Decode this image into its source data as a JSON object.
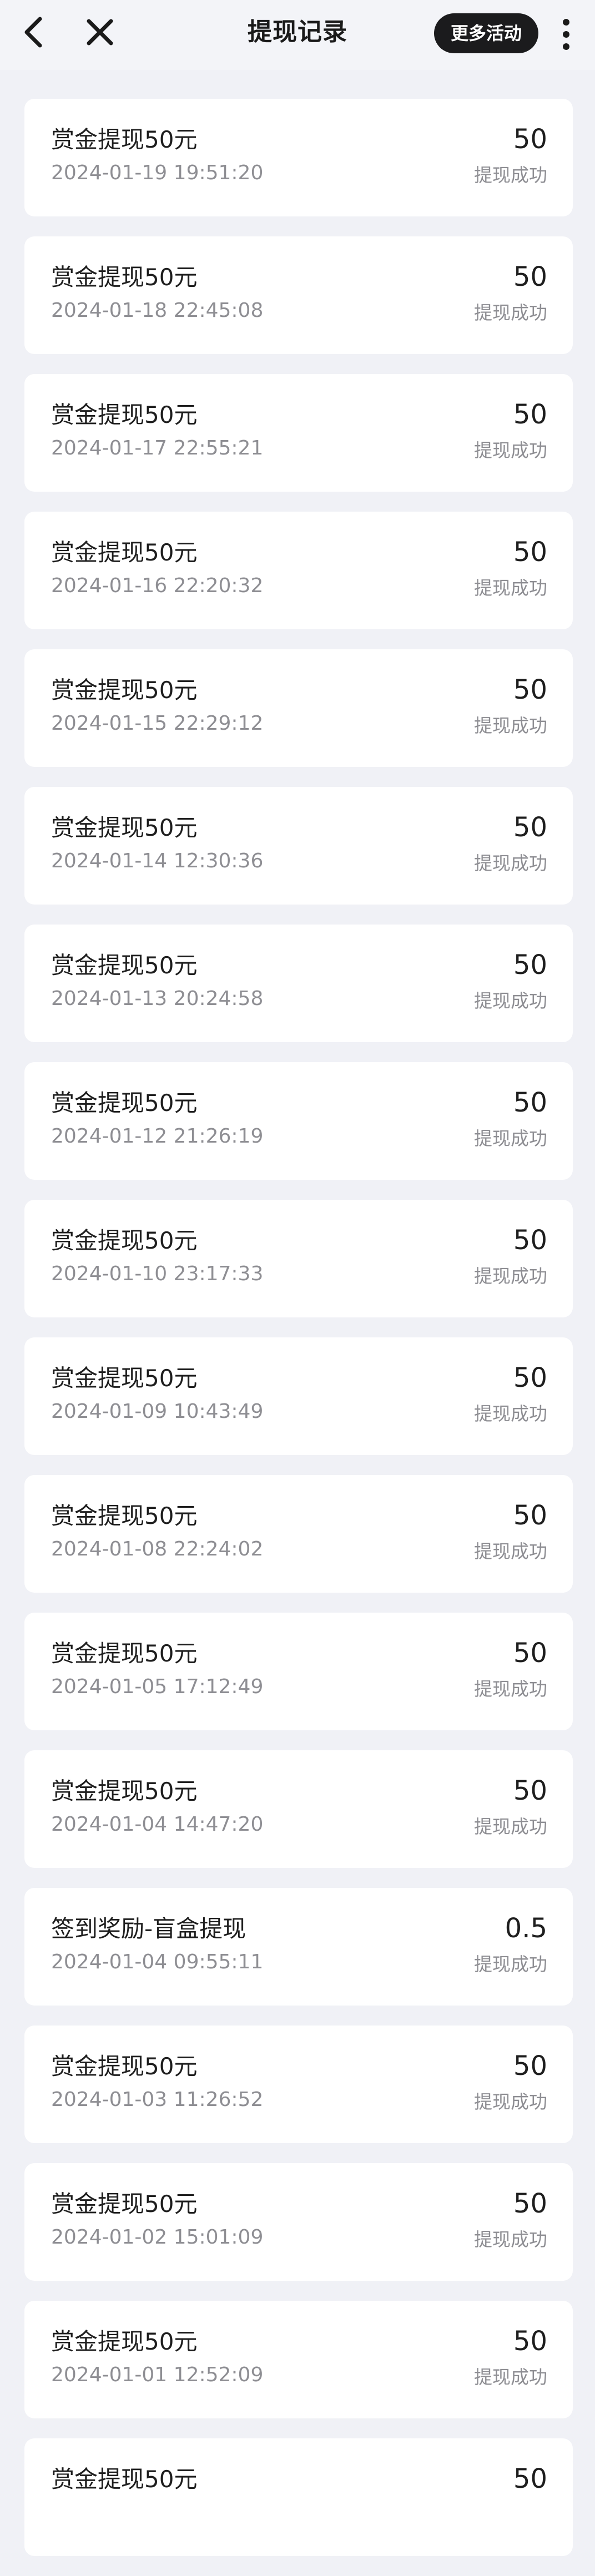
{
  "header": {
    "title": "提现记录",
    "more_label": "更多活动",
    "back_icon": "chevron-left-icon",
    "close_icon": "close-icon",
    "menu_icon": "vertical-ellipsis-icon"
  },
  "records": [
    {
      "title": "赏金提现50元",
      "time": "2024-01-19 19:51:20",
      "amount": "50",
      "status": "提现成功"
    },
    {
      "title": "赏金提现50元",
      "time": "2024-01-18 22:45:08",
      "amount": "50",
      "status": "提现成功"
    },
    {
      "title": "赏金提现50元",
      "time": "2024-01-17 22:55:21",
      "amount": "50",
      "status": "提现成功"
    },
    {
      "title": "赏金提现50元",
      "time": "2024-01-16 22:20:32",
      "amount": "50",
      "status": "提现成功"
    },
    {
      "title": "赏金提现50元",
      "time": "2024-01-15 22:29:12",
      "amount": "50",
      "status": "提现成功"
    },
    {
      "title": "赏金提现50元",
      "time": "2024-01-14 12:30:36",
      "amount": "50",
      "status": "提现成功"
    },
    {
      "title": "赏金提现50元",
      "time": "2024-01-13 20:24:58",
      "amount": "50",
      "status": "提现成功"
    },
    {
      "title": "赏金提现50元",
      "time": "2024-01-12 21:26:19",
      "amount": "50",
      "status": "提现成功"
    },
    {
      "title": "赏金提现50元",
      "time": "2024-01-10 23:17:33",
      "amount": "50",
      "status": "提现成功"
    },
    {
      "title": "赏金提现50元",
      "time": "2024-01-09 10:43:49",
      "amount": "50",
      "status": "提现成功"
    },
    {
      "title": "赏金提现50元",
      "time": "2024-01-08 22:24:02",
      "amount": "50",
      "status": "提现成功"
    },
    {
      "title": "赏金提现50元",
      "time": "2024-01-05 17:12:49",
      "amount": "50",
      "status": "提现成功"
    },
    {
      "title": "赏金提现50元",
      "time": "2024-01-04 14:47:20",
      "amount": "50",
      "status": "提现成功"
    },
    {
      "title": "签到奖励-盲盒提现",
      "time": "2024-01-04 09:55:11",
      "amount": "0.5",
      "status": "提现成功"
    },
    {
      "title": "赏金提现50元",
      "time": "2024-01-03 11:26:52",
      "amount": "50",
      "status": "提现成功"
    },
    {
      "title": "赏金提现50元",
      "time": "2024-01-02 15:01:09",
      "amount": "50",
      "status": "提现成功"
    },
    {
      "title": "赏金提现50元",
      "time": "2024-01-01 12:52:09",
      "amount": "50",
      "status": "提现成功"
    },
    {
      "title": "赏金提现50元",
      "time": "",
      "amount": "50",
      "status": ""
    }
  ]
}
